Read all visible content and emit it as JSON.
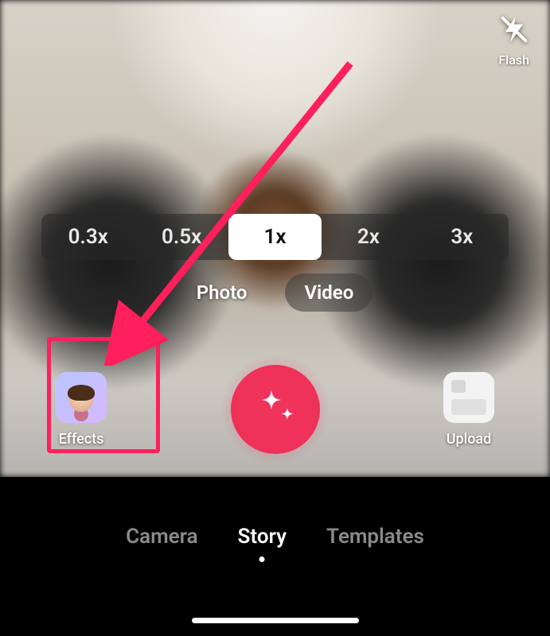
{
  "topControls": {
    "flash_label": "Flash"
  },
  "zoom": {
    "options": [
      "0.3x",
      "0.5x",
      "1x",
      "2x",
      "3x"
    ],
    "selected": "1x"
  },
  "captureMode": {
    "options": [
      "Photo",
      "Video"
    ],
    "selected": "Video"
  },
  "actions": {
    "effects_label": "Effects",
    "upload_label": "Upload"
  },
  "tabs": {
    "options": [
      "Camera",
      "Story",
      "Templates"
    ],
    "selected": "Story"
  },
  "annotation": {
    "highlight_target": "effects-button",
    "color": "#ff1f5a"
  }
}
